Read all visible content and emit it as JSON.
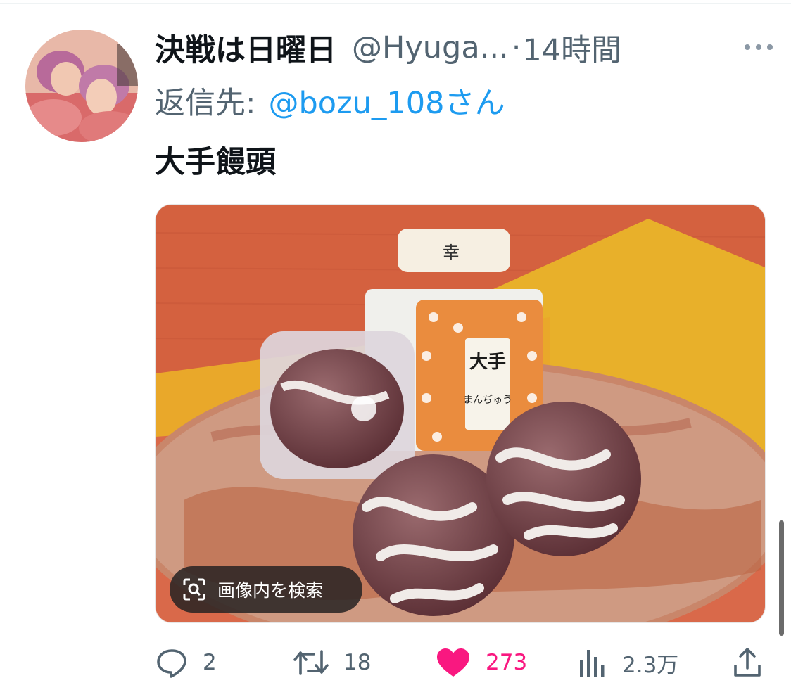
{
  "tweet": {
    "display_name": "決戦は日曜日",
    "handle": "@Hyuga...",
    "separator": "·",
    "timestamp": "14時間",
    "reply_prefix": "返信先:",
    "reply_mention": "@bozu_108さん",
    "text": "大手饅頭"
  },
  "media": {
    "image_search_label": "画像内を検索",
    "box_text": [
      "大手",
      "まんぢゅう"
    ],
    "lid_stamp": "幸"
  },
  "actions": {
    "replies": "2",
    "retweets": "18",
    "likes": "273",
    "views": "2.3万"
  },
  "colors": {
    "accent": "#1d9bf0",
    "like": "#f91880",
    "muted": "#536471"
  },
  "icons": {
    "more": "more-icon",
    "reply": "reply-icon",
    "retweet": "retweet-icon",
    "like": "heart-icon",
    "views": "views-icon",
    "share": "share-icon",
    "image_search": "image-search-icon"
  }
}
